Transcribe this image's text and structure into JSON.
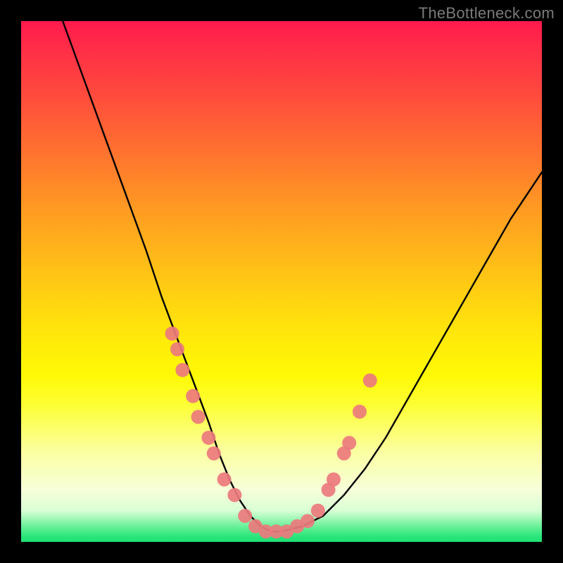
{
  "watermark": "TheBottleneck.com",
  "chart_data": {
    "type": "line",
    "title": "",
    "xlabel": "",
    "ylabel": "",
    "xlim": [
      0,
      100
    ],
    "ylim": [
      0,
      100
    ],
    "grid": false,
    "legend": false,
    "series": [
      {
        "name": "bottleneck-curve",
        "x": [
          8,
          12,
          16,
          20,
          24,
          27,
          30,
          33,
          36,
          38,
          40,
          42,
          44,
          46,
          48,
          50,
          54,
          58,
          62,
          66,
          70,
          74,
          78,
          82,
          86,
          90,
          94,
          98,
          100
        ],
        "y": [
          100,
          89,
          78,
          67,
          56,
          47,
          39,
          31,
          23,
          17,
          12,
          8,
          5,
          3,
          2,
          2,
          3,
          5,
          9,
          14,
          20,
          27,
          34,
          41,
          48,
          55,
          62,
          68,
          71
        ]
      }
    ],
    "markers": {
      "name": "highlighted-points",
      "color": "#ec7a7d",
      "radius_px": 10,
      "points_xy": [
        [
          29,
          40
        ],
        [
          30,
          37
        ],
        [
          31,
          33
        ],
        [
          33,
          28
        ],
        [
          34,
          24
        ],
        [
          36,
          20
        ],
        [
          37,
          17
        ],
        [
          39,
          12
        ],
        [
          41,
          9
        ],
        [
          43,
          5
        ],
        [
          45,
          3
        ],
        [
          47,
          2
        ],
        [
          49,
          2
        ],
        [
          51,
          2
        ],
        [
          53,
          3
        ],
        [
          55,
          4
        ],
        [
          57,
          6
        ],
        [
          59,
          10
        ],
        [
          60,
          12
        ],
        [
          62,
          17
        ],
        [
          63,
          19
        ],
        [
          65,
          25
        ],
        [
          67,
          31
        ]
      ]
    }
  }
}
